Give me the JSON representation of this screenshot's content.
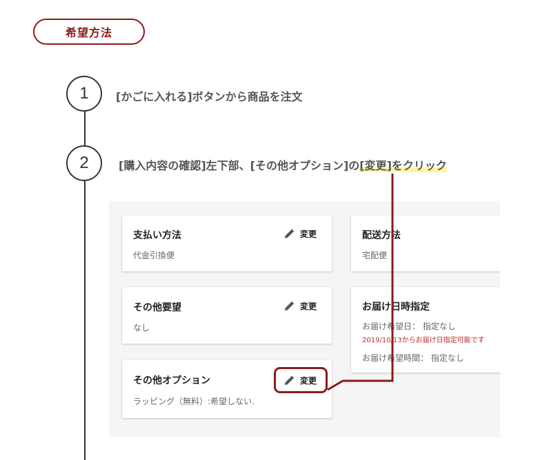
{
  "section_pill": "希望方法",
  "steps": [
    {
      "number": "1",
      "text": "[かごに入れる]ボタンから商品を注文"
    },
    {
      "number": "2",
      "text_before": "[購入内容の確認]左下部、[その他オプション]の",
      "text_highlight": "[変更]をクリック"
    }
  ],
  "cards": {
    "payment": {
      "title": "支払い方法",
      "value": "代金引換便",
      "edit_label": "変更"
    },
    "shipping": {
      "title": "配送方法",
      "value": "宅配便"
    },
    "requests": {
      "title": "その他要望",
      "value": "なし",
      "edit_label": "変更"
    },
    "delivery": {
      "title": "お届け日時指定",
      "date_line": "お届け希望日： 指定なし",
      "note": "2019/10/13からお届け日指定可能です",
      "time_line": "お届け希望時間： 指定なし"
    },
    "options": {
      "title": "その他オプション",
      "value": "ラッピング（無料）:希望しない.",
      "edit_label": "変更"
    }
  },
  "icons": {
    "edit": "pencil-icon"
  },
  "colors": {
    "accent": "#8b1a1a",
    "highlight": "#fff59d",
    "note_red": "#c62828"
  }
}
